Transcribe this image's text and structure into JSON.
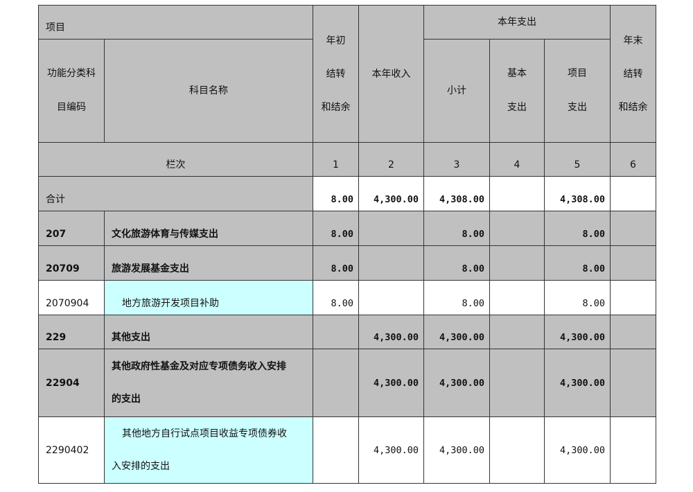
{
  "header": {
    "item": "项目",
    "func_code": "功能分类科\n目编码",
    "subject_name": "科目名称",
    "carry_begin": "年初\n结转\n和结余",
    "income": "本年收入",
    "expense": "本年支出",
    "subtotal": "小计",
    "basic": "基本\n支出",
    "project": "项目\n支出",
    "carry_end": "年末\n结转\n和结余",
    "column_row_label": "栏次",
    "col_numbers": [
      "1",
      "2",
      "3",
      "4",
      "5",
      "6"
    ]
  },
  "total": {
    "label": "合计",
    "values": [
      "8.00",
      "4,300.00",
      "4,308.00",
      "",
      "4,308.00",
      ""
    ]
  },
  "rows": [
    {
      "code": "207",
      "name": "文化旅游体育与传媒支出",
      "values": [
        "8.00",
        "",
        "8.00",
        "",
        "8.00",
        ""
      ]
    },
    {
      "code": "20709",
      "name": "旅游发展基金支出",
      "values": [
        "8.00",
        "",
        "8.00",
        "",
        "8.00",
        ""
      ]
    },
    {
      "code": "2070904",
      "name": "地方旅游开发项目补助",
      "values": [
        "8.00",
        "",
        "8.00",
        "",
        "8.00",
        ""
      ]
    },
    {
      "code": "229",
      "name": "其他支出",
      "values": [
        "",
        "4,300.00",
        "4,300.00",
        "",
        "4,300.00",
        ""
      ]
    },
    {
      "code": "22904",
      "name": "其他政府性基金及对应专项债务收入安排\n的支出",
      "values": [
        "",
        "4,300.00",
        "4,300.00",
        "",
        "4,300.00",
        ""
      ]
    },
    {
      "code": "2290402",
      "name": "其他地方自行试点项目收益专项债券收\n入安排的支出",
      "values": [
        "",
        "4,300.00",
        "4,300.00",
        "",
        "4,300.00",
        ""
      ]
    }
  ]
}
